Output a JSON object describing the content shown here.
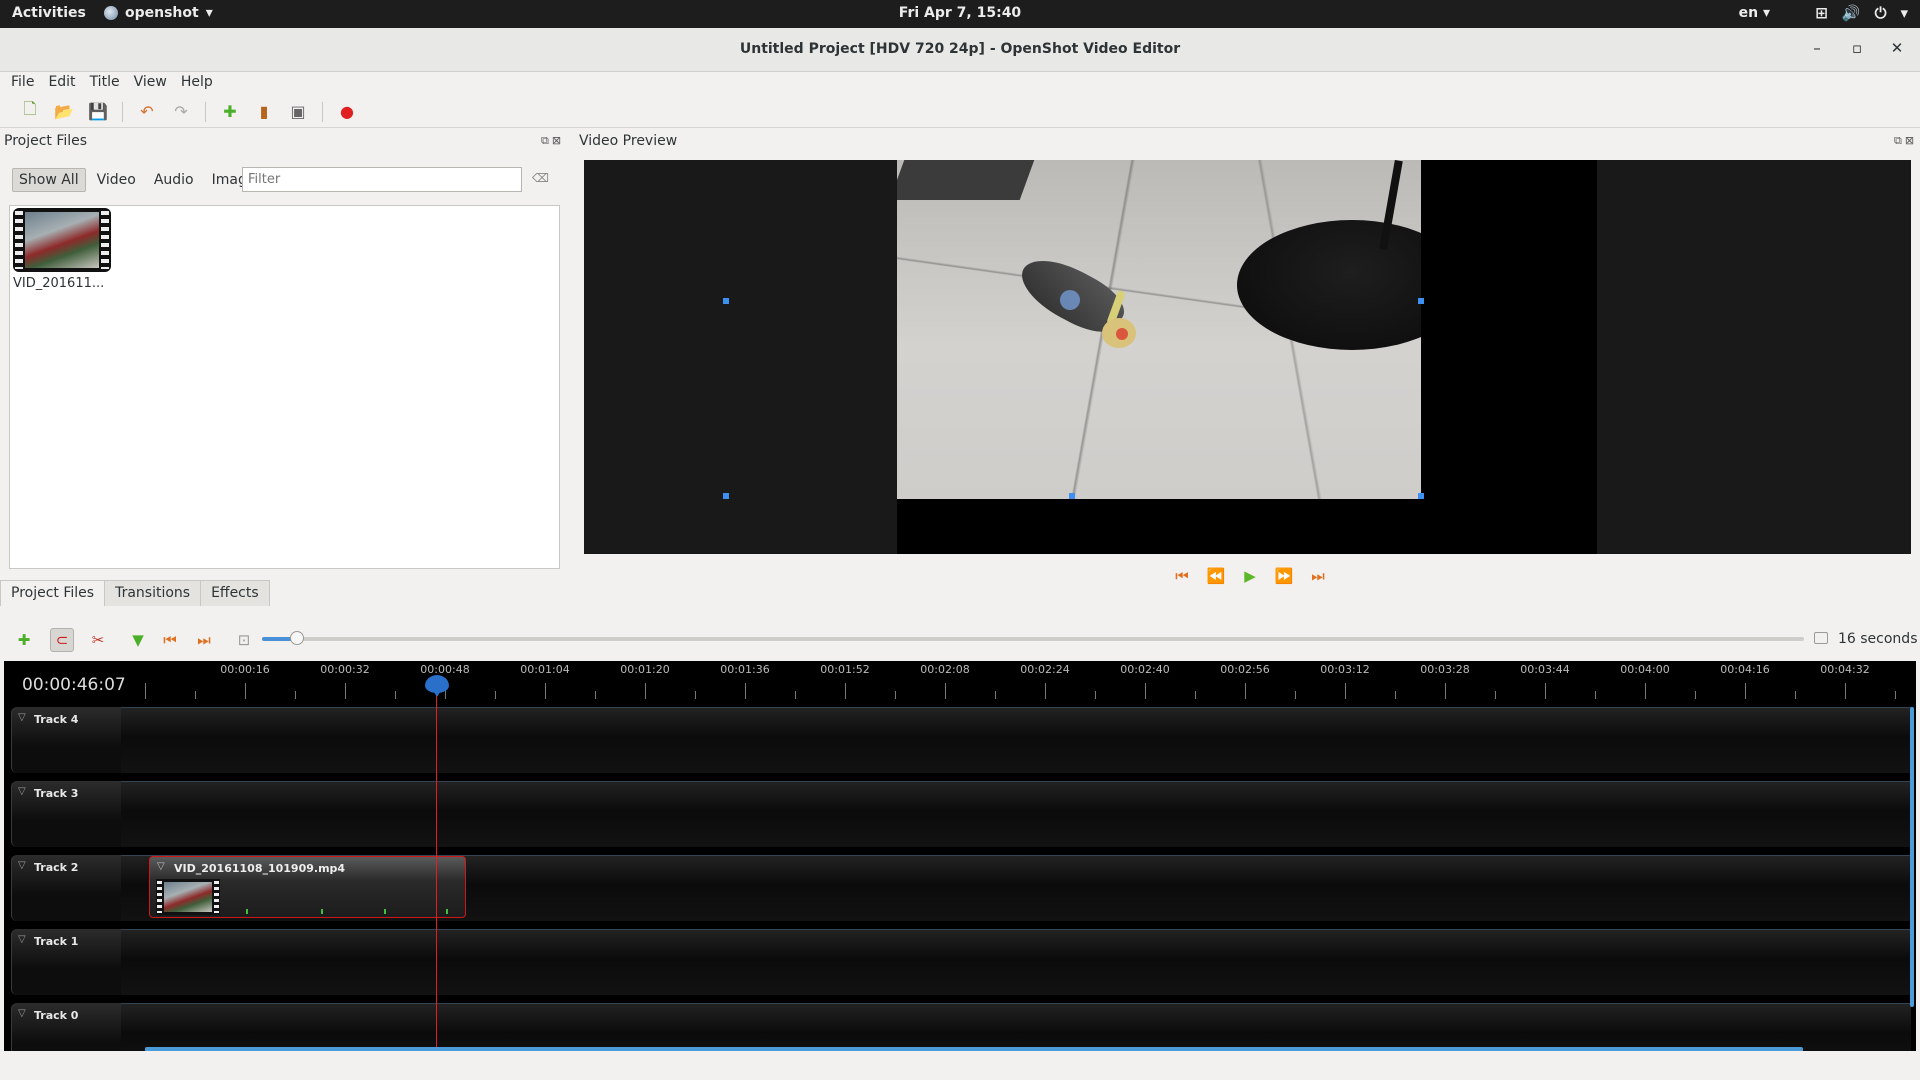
{
  "topbar": {
    "activities": "Activities",
    "app_name": "openshot",
    "clock": "Fri Apr  7, 15:40",
    "language": "en",
    "icons": [
      "network-icon",
      "volume-icon",
      "power-icon"
    ]
  },
  "window": {
    "title": "Untitled Project [HDV 720 24p] - OpenShot Video Editor",
    "controls": [
      "minimize",
      "maximize",
      "close"
    ]
  },
  "menu": {
    "items": [
      "File",
      "Edit",
      "Title",
      "View",
      "Help"
    ]
  },
  "toolbar": {
    "icons": [
      "new-project-icon",
      "open-project-icon",
      "save-project-icon",
      "undo-icon",
      "redo-icon",
      "import-files-icon",
      "choose-profile-icon",
      "fullscreen-icon",
      "export-video-icon"
    ]
  },
  "project_files": {
    "title": "Project Files",
    "filters": [
      "Show All",
      "Video",
      "Audio",
      "Image"
    ],
    "active_filter": "Show All",
    "filter_placeholder": "Filter",
    "files": [
      {
        "label": "VID_201611..."
      }
    ]
  },
  "bottom_tabs": [
    "Project Files",
    "Transitions",
    "Effects"
  ],
  "active_tab": "Project Files",
  "video_preview": {
    "title": "Video Preview"
  },
  "timeline": {
    "current_time": "00:00:46:07",
    "zoom_label": "16 seconds",
    "zoom_level": 0.02,
    "ruler_labels": [
      "00:00:16",
      "00:00:32",
      "00:00:48",
      "00:01:04",
      "00:01:20",
      "00:01:36",
      "00:01:52",
      "00:02:08",
      "00:02:24",
      "00:02:40",
      "00:02:56",
      "00:03:12",
      "00:03:28",
      "00:03:44",
      "00:04:00",
      "00:04:16",
      "00:04:32"
    ],
    "tracks": [
      "Track 4",
      "Track 3",
      "Track 2",
      "Track 1",
      "Track 0"
    ],
    "clip": {
      "name": "VID_20161108_101909.mp4",
      "track": "Track 2"
    }
  },
  "colors": {
    "accent": "#4a90d9",
    "playhead": "#e02020",
    "clip_border": "#d01818"
  }
}
